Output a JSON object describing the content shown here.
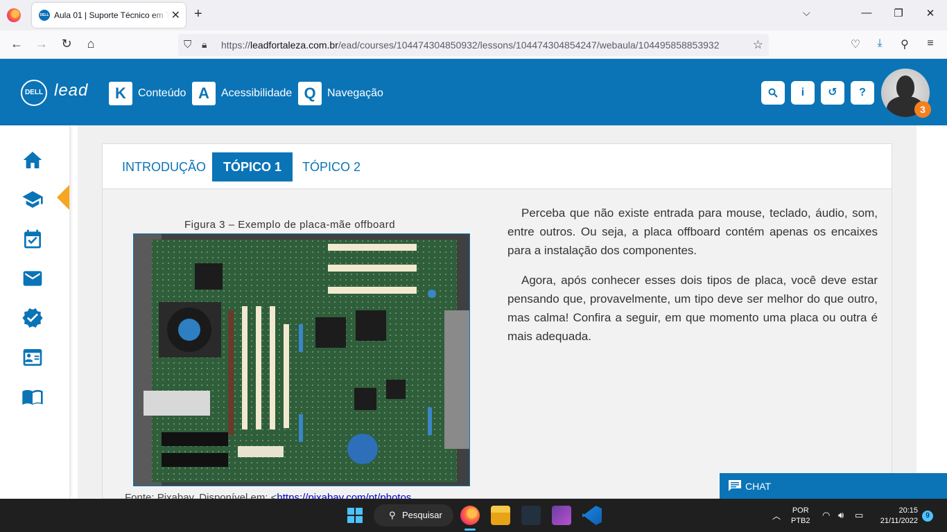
{
  "browser": {
    "tab_title": "Aula 01 | Suporte Técnico em Te",
    "url_prefix": "https://",
    "url_host": "leadfortaleza.com.br",
    "url_path": "/ead/courses/104474304850932/lessons/104474304854247/webaula/104495858853932"
  },
  "header": {
    "dell_logo_text": "DELL",
    "lead_logo_text": "lead",
    "shortcuts": [
      {
        "key": "K",
        "label": "Conteúdo"
      },
      {
        "key": "A",
        "label": "Acessibilidade"
      },
      {
        "key": "Q",
        "label": "Navegação"
      }
    ],
    "notification_count": "3"
  },
  "tabs": [
    {
      "label": "INTRODUÇÃO"
    },
    {
      "label": "TÓPICO 1"
    },
    {
      "label": "TÓPICO 2"
    }
  ],
  "figure": {
    "caption": "Figura 3 – Exemplo de placa-mãe offboard",
    "source_text": "Fonte: Pixabay. Disponível em: <",
    "source_link": "https://pixabay.com/pt/photos"
  },
  "content": {
    "paragraph1": "Perceba que não existe entrada para mouse, teclado, áudio, som, entre outros. Ou seja, a placa offboard contém apenas os encaixes para a instalação dos componentes.",
    "paragraph2": "Agora, após conhecer esses dois tipos de placa, você deve estar pensando que, provavelmente, um tipo deve ser melhor do que outro, mas calma! Confira a seguir, em que momento uma placa ou outra é mais adequada."
  },
  "chat": {
    "label": "CHAT"
  },
  "taskbar": {
    "search_label": "Pesquisar",
    "lang_top": "POR",
    "lang_bottom": "PTB2",
    "time": "20:15",
    "date": "21/11/2022",
    "notification_count": "9"
  },
  "colors": {
    "brand": "#0a74b7",
    "accent": "#f5a623",
    "badge": "#f4801f"
  }
}
